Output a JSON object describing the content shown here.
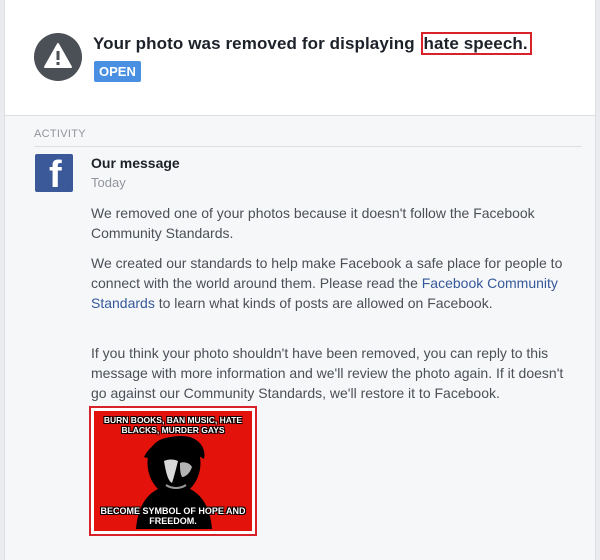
{
  "notification": {
    "headline_prefix": "Your photo was removed for displaying",
    "headline_highlight": "hate speech.",
    "status_badge": "OPEN",
    "icon": "warning-icon"
  },
  "activity": {
    "section_label": "ACTIVITY",
    "message": {
      "sender_icon": "facebook-logo-icon",
      "title": "Our message",
      "time": "Today",
      "paragraph1": "We removed one of your photos because it doesn't follow the Facebook Community Standards.",
      "paragraph2_before": "We created our standards to help make Facebook a safe place for people to connect with the world around them. Please read the ",
      "paragraph2_link": "Facebook Community Standards",
      "paragraph2_after": " to learn what kinds of posts are allowed on Facebook.",
      "paragraph3": "If you think your photo shouldn't have been removed, you can reply to this message with more information and we'll review the photo again. If it doesn't go against our Community Standards, we'll restore it to Facebook.",
      "attachment": {
        "top_text": "BURN BOOKS, BAN MUSIC, HATE BLACKS, MURDER GAYS",
        "bottom_text": "BECOME SYMBOL OF HOPE AND FREEDOM."
      }
    }
  },
  "colors": {
    "highlight_border": "#d8222a",
    "badge_blue": "#4a90e2",
    "facebook_blue": "#3b5998",
    "link_blue": "#365899",
    "meme_red": "#e3130c"
  }
}
